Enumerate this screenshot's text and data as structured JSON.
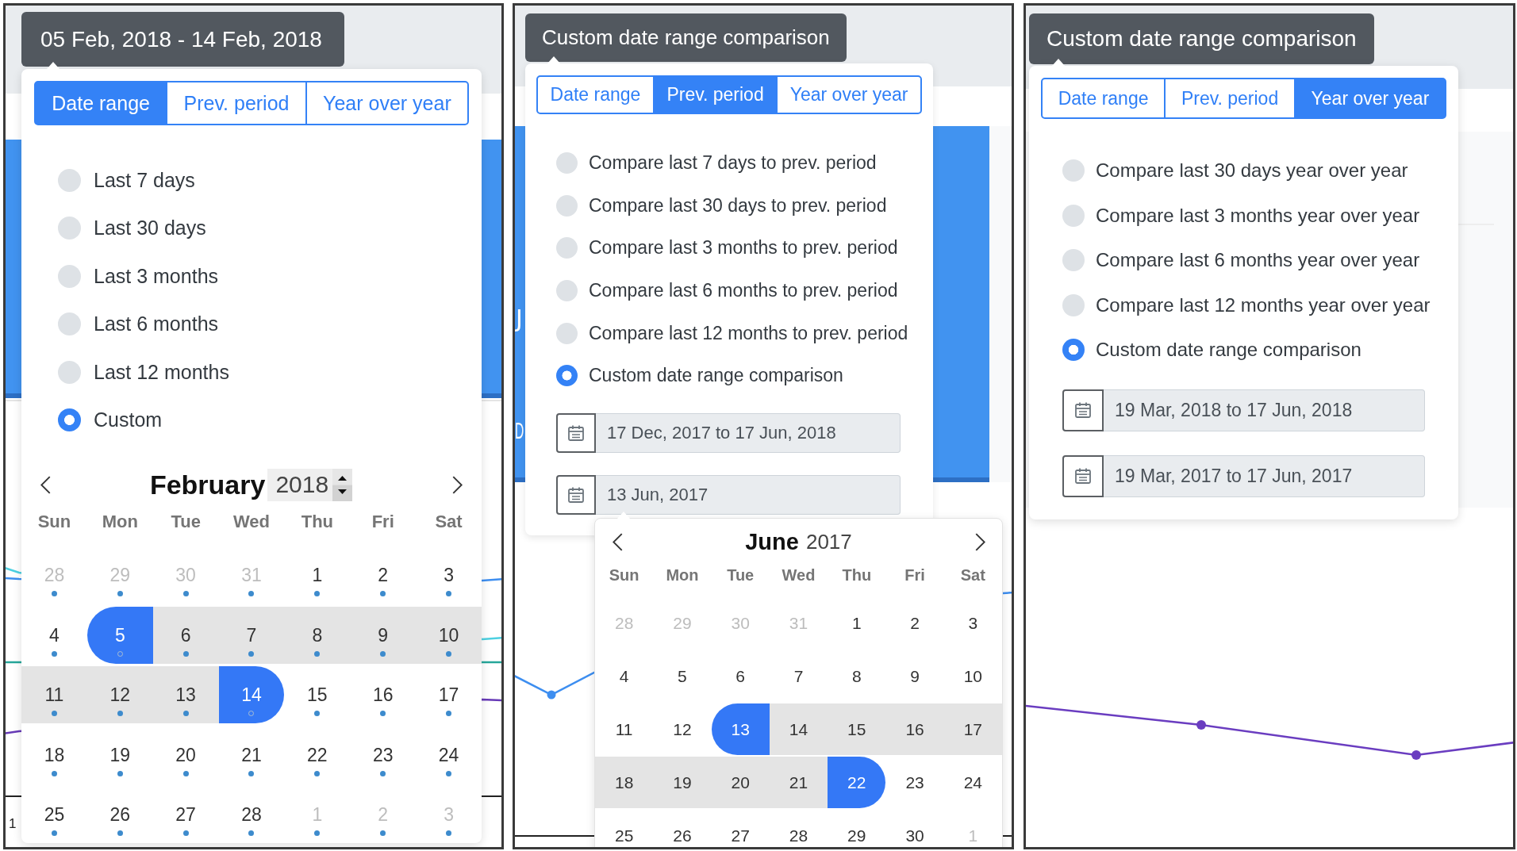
{
  "panels": [
    {
      "title": "05 Feb, 2018 - 14 Feb, 2018",
      "chart_labels": [
        "1"
      ],
      "tabs": [
        {
          "label": "Date range",
          "selected": true
        },
        {
          "label": "Prev. period",
          "selected": false
        },
        {
          "label": "Year over year",
          "selected": false
        }
      ],
      "options": [
        {
          "label": "Last 7 days",
          "selected": false
        },
        {
          "label": "Last 30 days",
          "selected": false
        },
        {
          "label": "Last 3 months",
          "selected": false
        },
        {
          "label": "Last 6 months",
          "selected": false
        },
        {
          "label": "Last 12 months",
          "selected": false
        },
        {
          "label": "Custom",
          "selected": true
        }
      ],
      "calendar": {
        "month": "February",
        "year": "2018",
        "year_spinner": true,
        "day_markers": true,
        "weekdays": [
          "Sun",
          "Mon",
          "Tue",
          "Wed",
          "Thu",
          "Fri",
          "Sat"
        ],
        "weeks": [
          [
            {
              "day": "28",
              "outside": true,
              "in_range": false,
              "selected": false
            },
            {
              "day": "29",
              "outside": true,
              "in_range": false,
              "selected": false
            },
            {
              "day": "30",
              "outside": true,
              "in_range": false,
              "selected": false
            },
            {
              "day": "31",
              "outside": true,
              "in_range": false,
              "selected": false
            },
            {
              "day": "1",
              "outside": false,
              "in_range": false,
              "selected": false
            },
            {
              "day": "2",
              "outside": false,
              "in_range": false,
              "selected": false
            },
            {
              "day": "3",
              "outside": false,
              "in_range": false,
              "selected": false
            }
          ],
          [
            {
              "day": "4",
              "outside": false,
              "in_range": false,
              "selected": false
            },
            {
              "day": "5",
              "outside": false,
              "in_range": true,
              "selected": true
            },
            {
              "day": "6",
              "outside": false,
              "in_range": true,
              "selected": false
            },
            {
              "day": "7",
              "outside": false,
              "in_range": true,
              "selected": false
            },
            {
              "day": "8",
              "outside": false,
              "in_range": true,
              "selected": false
            },
            {
              "day": "9",
              "outside": false,
              "in_range": true,
              "selected": false
            },
            {
              "day": "10",
              "outside": false,
              "in_range": true,
              "selected": false
            }
          ],
          [
            {
              "day": "11",
              "outside": false,
              "in_range": true,
              "selected": false
            },
            {
              "day": "12",
              "outside": false,
              "in_range": true,
              "selected": false
            },
            {
              "day": "13",
              "outside": false,
              "in_range": true,
              "selected": false
            },
            {
              "day": "14",
              "outside": false,
              "in_range": true,
              "selected": true
            },
            {
              "day": "15",
              "outside": false,
              "in_range": false,
              "selected": false
            },
            {
              "day": "16",
              "outside": false,
              "in_range": false,
              "selected": false
            },
            {
              "day": "17",
              "outside": false,
              "in_range": false,
              "selected": false
            }
          ],
          [
            {
              "day": "18",
              "outside": false,
              "in_range": false,
              "selected": false
            },
            {
              "day": "19",
              "outside": false,
              "in_range": false,
              "selected": false
            },
            {
              "day": "20",
              "outside": false,
              "in_range": false,
              "selected": false
            },
            {
              "day": "21",
              "outside": false,
              "in_range": false,
              "selected": false
            },
            {
              "day": "22",
              "outside": false,
              "in_range": false,
              "selected": false
            },
            {
              "day": "23",
              "outside": false,
              "in_range": false,
              "selected": false
            },
            {
              "day": "24",
              "outside": false,
              "in_range": false,
              "selected": false
            }
          ],
          [
            {
              "day": "25",
              "outside": false,
              "in_range": false,
              "selected": false
            },
            {
              "day": "26",
              "outside": false,
              "in_range": false,
              "selected": false
            },
            {
              "day": "27",
              "outside": false,
              "in_range": false,
              "selected": false
            },
            {
              "day": "28",
              "outside": false,
              "in_range": false,
              "selected": false
            },
            {
              "day": "1",
              "outside": true,
              "in_range": false,
              "selected": false
            },
            {
              "day": "2",
              "outside": true,
              "in_range": false,
              "selected": false
            },
            {
              "day": "3",
              "outside": true,
              "in_range": false,
              "selected": false
            }
          ]
        ]
      }
    },
    {
      "title": "Custom date range comparison",
      "chart_labels": [
        "J",
        "D"
      ],
      "tabs": [
        {
          "label": "Date range",
          "selected": false
        },
        {
          "label": "Prev. period",
          "selected": true
        },
        {
          "label": "Year over year",
          "selected": false
        }
      ],
      "options": [
        {
          "label": "Compare last 7 days to prev. period",
          "selected": false
        },
        {
          "label": "Compare last 30 days to prev. period",
          "selected": false
        },
        {
          "label": "Compare last 3 months to prev. period",
          "selected": false
        },
        {
          "label": "Compare last 6 months to prev. period",
          "selected": false
        },
        {
          "label": "Compare last 12 months to prev. period",
          "selected": false
        },
        {
          "label": "Custom date range comparison",
          "selected": true
        }
      ],
      "fields": [
        {
          "value": "17 Dec, 2017 to 17 Jun, 2018"
        },
        {
          "value": "13 Jun, 2017",
          "calendar": {
            "month": "June",
            "year": "2017",
            "year_spinner": false,
            "day_markers": false,
            "weekdays": [
              "Sun",
              "Mon",
              "Tue",
              "Wed",
              "Thu",
              "Fri",
              "Sat"
            ],
            "weeks": [
              [
                {
                  "day": "28",
                  "outside": true,
                  "in_range": false,
                  "selected": false
                },
                {
                  "day": "29",
                  "outside": true,
                  "in_range": false,
                  "selected": false
                },
                {
                  "day": "30",
                  "outside": true,
                  "in_range": false,
                  "selected": false
                },
                {
                  "day": "31",
                  "outside": true,
                  "in_range": false,
                  "selected": false
                },
                {
                  "day": "1",
                  "outside": false,
                  "in_range": false,
                  "selected": false
                },
                {
                  "day": "2",
                  "outside": false,
                  "in_range": false,
                  "selected": false
                },
                {
                  "day": "3",
                  "outside": false,
                  "in_range": false,
                  "selected": false
                }
              ],
              [
                {
                  "day": "4",
                  "outside": false,
                  "in_range": false,
                  "selected": false
                },
                {
                  "day": "5",
                  "outside": false,
                  "in_range": false,
                  "selected": false
                },
                {
                  "day": "6",
                  "outside": false,
                  "in_range": false,
                  "selected": false
                },
                {
                  "day": "7",
                  "outside": false,
                  "in_range": false,
                  "selected": false
                },
                {
                  "day": "8",
                  "outside": false,
                  "in_range": false,
                  "selected": false
                },
                {
                  "day": "9",
                  "outside": false,
                  "in_range": false,
                  "selected": false
                },
                {
                  "day": "10",
                  "outside": false,
                  "in_range": false,
                  "selected": false
                }
              ],
              [
                {
                  "day": "11",
                  "outside": false,
                  "in_range": false,
                  "selected": false
                },
                {
                  "day": "12",
                  "outside": false,
                  "in_range": false,
                  "selected": false
                },
                {
                  "day": "13",
                  "outside": false,
                  "in_range": true,
                  "selected": true
                },
                {
                  "day": "14",
                  "outside": false,
                  "in_range": true,
                  "selected": false
                },
                {
                  "day": "15",
                  "outside": false,
                  "in_range": true,
                  "selected": false
                },
                {
                  "day": "16",
                  "outside": false,
                  "in_range": true,
                  "selected": false
                },
                {
                  "day": "17",
                  "outside": false,
                  "in_range": true,
                  "selected": false
                }
              ],
              [
                {
                  "day": "18",
                  "outside": false,
                  "in_range": true,
                  "selected": false
                },
                {
                  "day": "19",
                  "outside": false,
                  "in_range": true,
                  "selected": false
                },
                {
                  "day": "20",
                  "outside": false,
                  "in_range": true,
                  "selected": false
                },
                {
                  "day": "21",
                  "outside": false,
                  "in_range": true,
                  "selected": false
                },
                {
                  "day": "22",
                  "outside": false,
                  "in_range": true,
                  "selected": true
                },
                {
                  "day": "23",
                  "outside": false,
                  "in_range": false,
                  "selected": false
                },
                {
                  "day": "24",
                  "outside": false,
                  "in_range": false,
                  "selected": false
                }
              ],
              [
                {
                  "day": "25",
                  "outside": false,
                  "in_range": false,
                  "selected": false
                },
                {
                  "day": "26",
                  "outside": false,
                  "in_range": false,
                  "selected": false
                },
                {
                  "day": "27",
                  "outside": false,
                  "in_range": false,
                  "selected": false
                },
                {
                  "day": "28",
                  "outside": false,
                  "in_range": false,
                  "selected": false
                },
                {
                  "day": "29",
                  "outside": false,
                  "in_range": false,
                  "selected": false
                },
                {
                  "day": "30",
                  "outside": false,
                  "in_range": false,
                  "selected": false
                },
                {
                  "day": "1",
                  "outside": true,
                  "in_range": false,
                  "selected": false
                }
              ]
            ]
          }
        }
      ]
    },
    {
      "title": "Custom date range comparison",
      "tabs": [
        {
          "label": "Date range",
          "selected": false
        },
        {
          "label": "Prev. period",
          "selected": false
        },
        {
          "label": "Year over year",
          "selected": true
        }
      ],
      "options": [
        {
          "label": "Compare last 30 days year over year",
          "selected": false
        },
        {
          "label": "Compare last 3 months year over year",
          "selected": false
        },
        {
          "label": "Compare last 6 months year over year",
          "selected": false
        },
        {
          "label": "Compare last 12 months year over year",
          "selected": false
        },
        {
          "label": "Custom date range comparison",
          "selected": true
        }
      ],
      "fields": [
        {
          "value": "19 Mar, 2018 to 17 Jun, 2018"
        },
        {
          "value": "19 Mar, 2017 to 17 Jun, 2017"
        }
      ]
    }
  ]
}
